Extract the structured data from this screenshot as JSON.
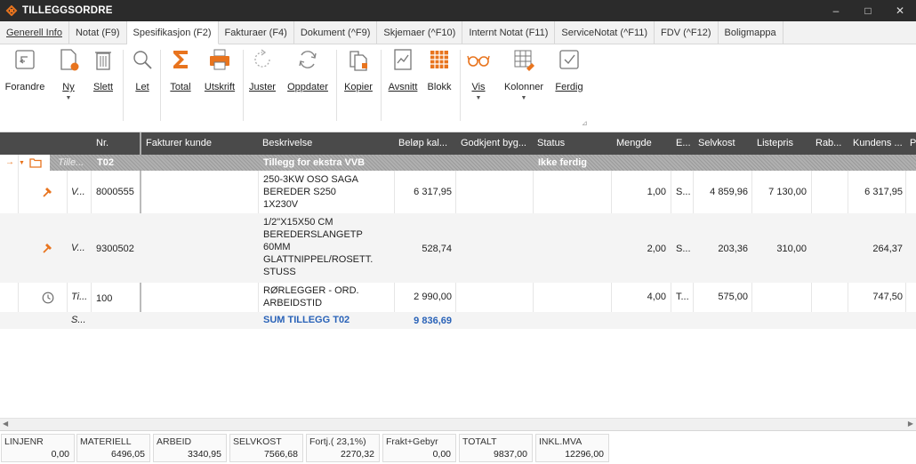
{
  "window": {
    "title": "TILLEGGSORDRE",
    "minimize": "–",
    "maximize": "□",
    "close": "✕"
  },
  "tabs": [
    {
      "label": "Generell Info"
    },
    {
      "label": "Notat (F9)"
    },
    {
      "label": "Spesifikasjon (F2)"
    },
    {
      "label": "Fakturaer (F4)"
    },
    {
      "label": "Dokument (^F9)"
    },
    {
      "label": "Skjemaer (^F10)"
    },
    {
      "label": "Internt Notat (F11)"
    },
    {
      "label": "ServiceNotat (^F11)"
    },
    {
      "label": "FDV (^F12)"
    },
    {
      "label": "Boligmappa"
    }
  ],
  "ribbon": {
    "forandre": "Forandre",
    "ny": "Ny",
    "slett": "Slett",
    "let": "Let",
    "total": "Total",
    "utskrift": "Utskrift",
    "juster": "Juster",
    "oppdater": "Oppdater",
    "kopier": "Kopier",
    "avsnitt": "Avsnitt",
    "blokk": "Blokk",
    "vis": "Vis",
    "kolonner": "Kolonner",
    "ferdig": "Ferdig"
  },
  "grid": {
    "headers": {
      "nr": "Nr.",
      "fakturer_kunde": "Fakturer kunde",
      "beskrivelse": "Beskrivelse",
      "belop": "Beløp kal...",
      "godkjent": "Godkjent byg...",
      "status": "Status",
      "mengde": "Mengde",
      "e": "E...",
      "selvkost": "Selvkost",
      "listepris": "Listepris",
      "rab": "Rab...",
      "kundens": "Kundens ...",
      "p": "P"
    },
    "group": {
      "type": "Tille...",
      "nr": "T02",
      "beskrivelse": "Tillegg for ekstra VVB",
      "status": "Ikke ferdig"
    },
    "rows": [
      {
        "type": "V...",
        "nr": "8000555",
        "desc1": "250-3KW OSO SAGA",
        "desc2": "BEREDER S250",
        "desc3": "1X230V",
        "belop": "6 317,95",
        "mengde": "1,00",
        "e": "S...",
        "selvkost": "4 859,96",
        "listepris": "7 130,00",
        "kundens": "6 317,95"
      },
      {
        "type": "V...",
        "nr": "9300502",
        "desc1": "1/2\"X15X50 CM",
        "desc2": "BEREDERSLANGETP",
        "desc3": "60MM",
        "desc4": "GLATTNIPPEL/ROSETT.",
        "desc5": "STUSS",
        "belop": "528,74",
        "mengde": "2,00",
        "e": "S...",
        "selvkost": "203,36",
        "listepris": "310,00",
        "kundens": "264,37"
      },
      {
        "type": "Ti...",
        "nr": "100",
        "desc1": "RØRLEGGER - ORD.",
        "desc2": "ARBEIDSTID",
        "belop": "2 990,00",
        "mengde": "4,00",
        "e": "T...",
        "selvkost": "575,00",
        "kundens": "747,50"
      }
    ],
    "sum": {
      "type": "S...",
      "beskrivelse": "SUM TILLEGG T02",
      "belop": "9 836,69"
    }
  },
  "totals": [
    {
      "label": "LINJENR",
      "value": "0,00"
    },
    {
      "label": "MATERIELL",
      "value": "6496,05"
    },
    {
      "label": "ARBEID",
      "value": "3340,95"
    },
    {
      "label": "SELVKOST",
      "value": "7566,68"
    },
    {
      "label": "Fortj.( 23,1%)",
      "value": "2270,32"
    },
    {
      "label": "Frakt+Gebyr",
      "value": "0,00"
    },
    {
      "label": "TOTALT",
      "value": "9837,00"
    },
    {
      "label": "INKL.MVA",
      "value": "12296,00"
    }
  ],
  "colors": {
    "accent_orange": "#e8741e",
    "header_bg": "#4a4a4a",
    "sum_blue": "#2a63b8"
  }
}
